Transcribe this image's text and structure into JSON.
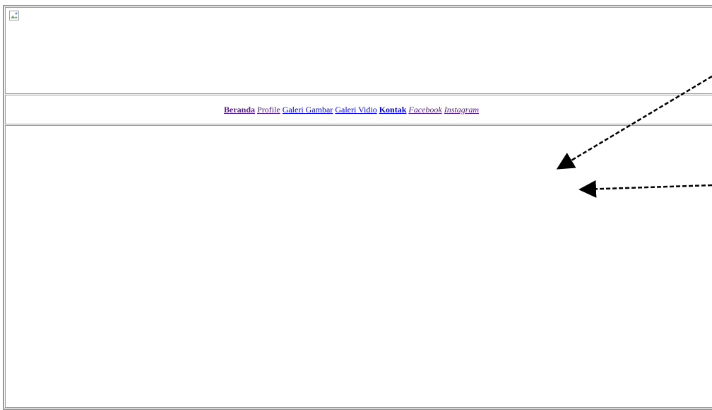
{
  "header": {
    "banner_image": "broken-image-icon"
  },
  "nav": {
    "links": [
      {
        "label": "Beranda",
        "style": "bold",
        "state": "visited"
      },
      {
        "label": "Profile",
        "style": "normal",
        "state": "visited"
      },
      {
        "label": "Galeri Gambar",
        "style": "normal",
        "state": "unvisited"
      },
      {
        "label": "Galeri Vidio",
        "style": "normal",
        "state": "unvisited"
      },
      {
        "label": "Kontak",
        "style": "bold",
        "state": "unvisited"
      },
      {
        "label": "Facebook",
        "style": "italic",
        "state": "visited"
      },
      {
        "label": "Instagram",
        "style": "italic",
        "state": "visited"
      }
    ]
  },
  "colors": {
    "visited_link": "#551a8b",
    "unvisited_link": "#0000ee",
    "border": "#9a9a9a",
    "arrow": "#000000"
  }
}
